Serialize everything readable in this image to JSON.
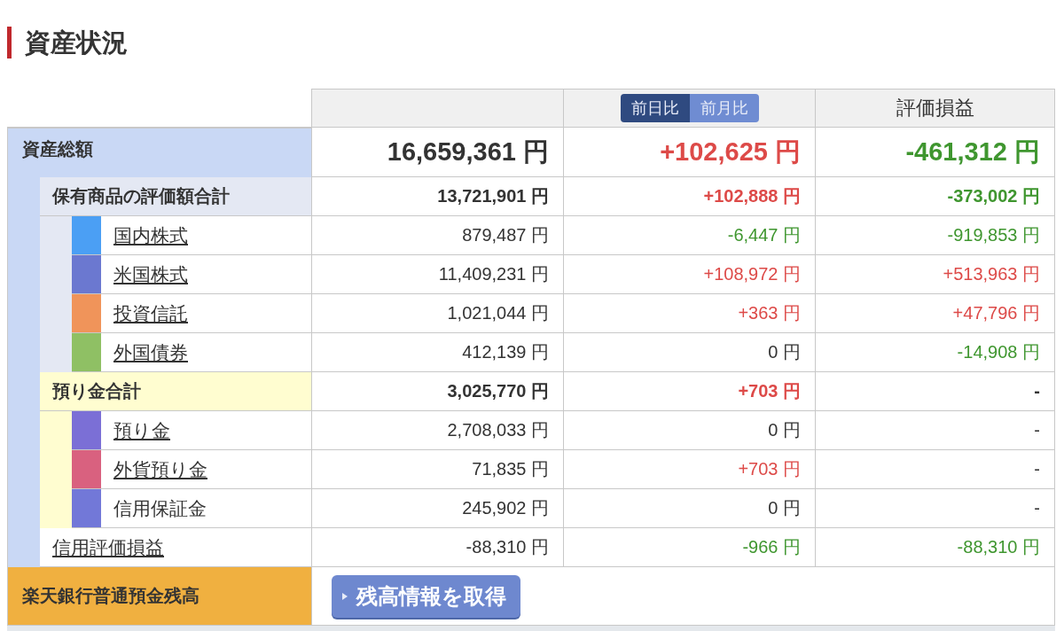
{
  "title": "資産状況",
  "header": {
    "toggle": [
      {
        "label": "前日比",
        "selected": true
      },
      {
        "label": "前月比",
        "selected": false
      }
    ],
    "column_4": "評価損益"
  },
  "total": {
    "label": "資産総額",
    "color": "#c9d8f5",
    "value": "16,659,361 円",
    "day": {
      "text": "+102,625 円",
      "color": "#dd4a48"
    },
    "pl": {
      "text": "-461,312 円",
      "color": "#3f962f"
    },
    "children": [
      {
        "label": "保有商品の評価額合計",
        "color": "#e4e8f3",
        "linked": false,
        "value": "13,721,901 円",
        "day": {
          "text": "+102,888 円",
          "color": "#dd4a48"
        },
        "pl": {
          "text": "-373,002 円",
          "color": "#3f962f"
        },
        "children": [
          {
            "label": "国内株式",
            "color": "#4b9ff4",
            "linked": true,
            "value": "879,487 円",
            "day": {
              "text": "-6,447 円",
              "color": "#3f962f"
            },
            "pl": {
              "text": "-919,853 円",
              "color": "#3f962f"
            }
          },
          {
            "label": "米国株式",
            "color": "#6b78d0",
            "linked": true,
            "value": "11,409,231 円",
            "day": {
              "text": "+108,972 円",
              "color": "#dd4a48"
            },
            "pl": {
              "text": "+513,963 円",
              "color": "#dd4a48"
            }
          },
          {
            "label": "投資信託",
            "color": "#f0945a",
            "linked": true,
            "value": "1,021,044 円",
            "day": {
              "text": "+363 円",
              "color": "#dd4a48"
            },
            "pl": {
              "text": "+47,796 円",
              "color": "#dd4a48"
            }
          },
          {
            "label": "外国債券",
            "color": "#8fc064",
            "linked": true,
            "value": "412,139 円",
            "day": {
              "text": "0 円",
              "color": "#333333"
            },
            "pl": {
              "text": "-14,908 円",
              "color": "#3f962f"
            }
          }
        ]
      },
      {
        "label": "預り金合計",
        "color": "#fffdd0",
        "linked": false,
        "value": "3,025,770 円",
        "day": {
          "text": "+703 円",
          "color": "#dd4a48"
        },
        "pl": {
          "text": "-",
          "color": "#333333"
        },
        "children": [
          {
            "label": "預り金",
            "color": "#7b6fd6",
            "linked": true,
            "value": "2,708,033 円",
            "day": {
              "text": "0 円",
              "color": "#333333"
            },
            "pl": {
              "text": "-",
              "color": "#333333"
            }
          },
          {
            "label": "外貨預り金",
            "color": "#d9617f",
            "linked": true,
            "value": "71,835 円",
            "day": {
              "text": "+703 円",
              "color": "#dd4a48"
            },
            "pl": {
              "text": "-",
              "color": "#333333"
            }
          },
          {
            "label": "信用保証金",
            "color": "#7278d8",
            "linked": false,
            "value": "245,902 円",
            "day": {
              "text": "0 円",
              "color": "#333333"
            },
            "pl": {
              "text": "-",
              "color": "#333333"
            }
          }
        ]
      },
      {
        "label": "信用評価損益",
        "linked": true,
        "value": "-88,310 円",
        "day": {
          "text": "-966 円",
          "color": "#3f962f"
        },
        "pl": {
          "text": "-88,310 円",
          "color": "#3f962f"
        }
      }
    ]
  },
  "bank": {
    "label": "楽天銀行普通預金残高",
    "button": "残高情報を取得"
  }
}
